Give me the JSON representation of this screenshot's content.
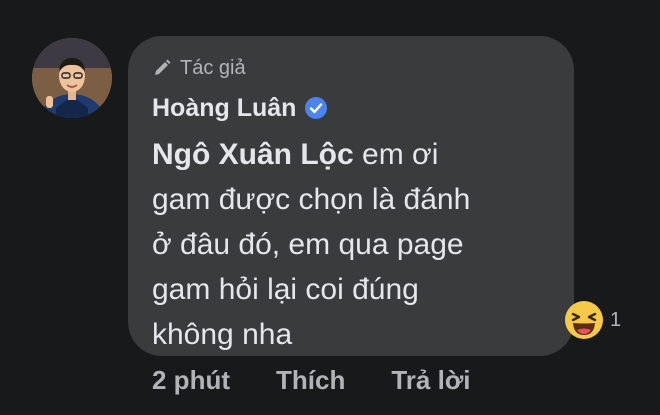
{
  "comment": {
    "author_badge": "Tác giả",
    "author_name": "Hoàng Luân",
    "mention": "Ngô Xuân Lộc",
    "text_line1": " em ơi",
    "text_line2": "gam được chọn là đánh",
    "text_line3": "ở đâu đó, em qua page",
    "text_line4": "gam hỏi lại coi đúng",
    "text_line5": "không nha"
  },
  "reaction": {
    "icon": "haha-emoji-icon",
    "count": "1"
  },
  "actions": {
    "time": "2 phút",
    "like": "Thích",
    "reply": "Trả lời"
  },
  "colors": {
    "background": "#18191a",
    "bubble": "#3a3b3c",
    "primary_text": "#e4e6eb",
    "secondary_text": "#b0b3b8",
    "verified": "#4b84f0"
  }
}
